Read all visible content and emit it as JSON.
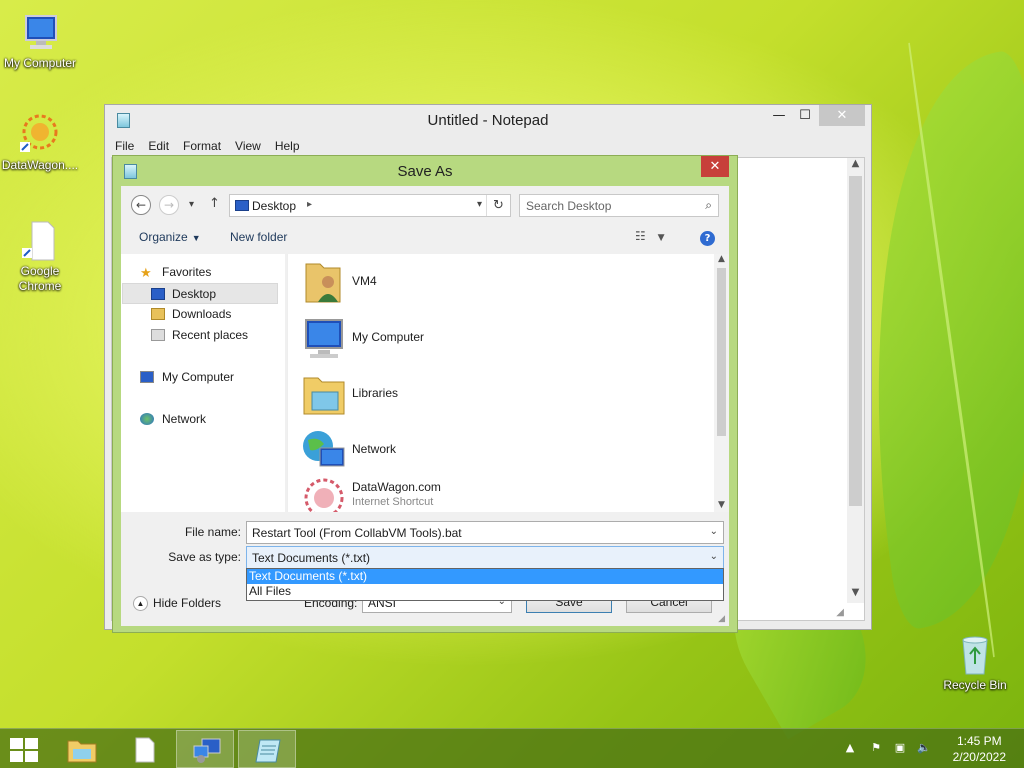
{
  "desktop": {
    "icons": [
      {
        "label": "My Computer",
        "icon": "computer-icon"
      },
      {
        "label": "DataWagon....",
        "icon": "datawagon-icon"
      },
      {
        "label": "Google Chrome",
        "icon": "chrome-shortcut-icon"
      },
      {
        "label": "Recycle Bin",
        "icon": "recycle-bin-icon"
      }
    ]
  },
  "notepad": {
    "title": "Untitled - Notepad",
    "menu": [
      "File",
      "Edit",
      "Format",
      "View",
      "Help"
    ],
    "minimize": "—",
    "maximize": "☐",
    "close": "✕"
  },
  "save_dialog": {
    "title": "Save As",
    "close": "✕",
    "address": {
      "location": "Desktop"
    },
    "search": {
      "placeholder": "Search Desktop"
    },
    "toolbar": {
      "organize": "Organize",
      "new_folder": "New folder",
      "help": "?"
    },
    "nav": {
      "favorites": "Favorites",
      "desktop": "Desktop",
      "downloads": "Downloads",
      "recent_places": "Recent places",
      "my_computer": "My Computer",
      "network": "Network"
    },
    "items": [
      {
        "name": "VM4",
        "icon": "user-folder-icon"
      },
      {
        "name": "My Computer",
        "icon": "computer-icon"
      },
      {
        "name": "Libraries",
        "icon": "libraries-icon"
      },
      {
        "name": "Network",
        "icon": "network-icon"
      },
      {
        "name": "DataWagon.com",
        "sub": "Internet Shortcut",
        "icon": "datawagon-icon"
      }
    ],
    "file_name_label": "File name:",
    "file_name_value": "Restart Tool (From CollabVM Tools).bat",
    "save_type_label": "Save as type:",
    "save_type_value": "Text Documents (*.txt)",
    "save_type_options": [
      "Text Documents (*.txt)",
      "All Files"
    ],
    "encoding_label": "Encoding:",
    "encoding_value": "ANSI",
    "hide_folders": "Hide Folders",
    "save_button": "Save",
    "cancel_button": "Cancel"
  },
  "taskbar": {
    "clock_time": "1:45 PM",
    "clock_date": "2/20/2022"
  },
  "colors": {
    "dialog_frame": "#b7d980",
    "close_red": "#c7403a",
    "selection_blue": "#3399ff"
  }
}
